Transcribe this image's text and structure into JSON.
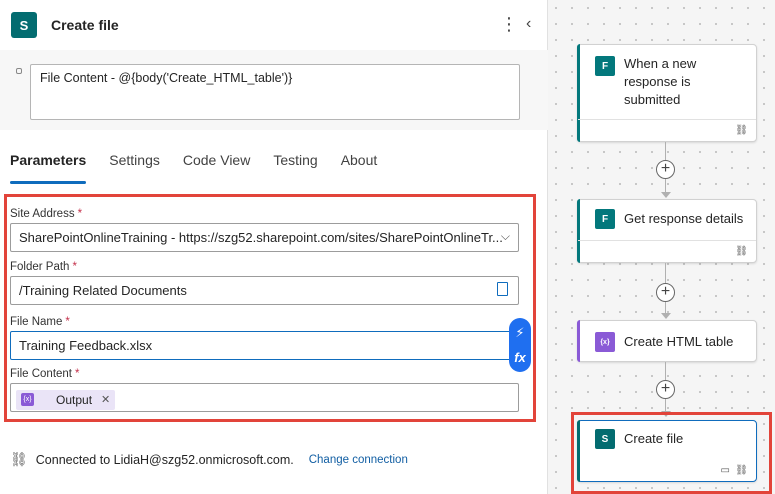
{
  "panel": {
    "title": "Create file",
    "logo_letter": "S",
    "description": "File Content - @{body('Create_HTML_table')}",
    "tabs": [
      {
        "label": "Parameters",
        "active": true
      },
      {
        "label": "Settings",
        "active": false
      },
      {
        "label": "Code View",
        "active": false
      },
      {
        "label": "Testing",
        "active": false
      },
      {
        "label": "About",
        "active": false
      }
    ],
    "fields": {
      "site_address": {
        "label": "Site Address",
        "required": "*",
        "value": "SharePointOnlineTraining - https://szg52.sharepoint.com/sites/SharePointOnlineTr..."
      },
      "folder_path": {
        "label": "Folder Path",
        "required": "*",
        "value": "/Training Related Documents"
      },
      "file_name": {
        "label": "File Name",
        "required": "*",
        "value": "Training Feedback.xlsx"
      },
      "file_content": {
        "label": "File Content",
        "required": "*",
        "token_label": "Output",
        "token_icon": "{x}"
      }
    },
    "dynamic_content_glyph": "⚡",
    "expression_glyph": "fx",
    "connection": {
      "text": "Connected to LidiaH@szg52.onmicrosoft.com.",
      "change_label": "Change connection"
    }
  },
  "flow": {
    "steps": [
      {
        "title": "When a new response is submitted",
        "icon": "forms-icon",
        "icon_color": "#03787c"
      },
      {
        "title": "Get response details",
        "icon": "forms-icon",
        "icon_color": "#03787c"
      },
      {
        "title": "Create HTML table",
        "icon": "data-operation-icon",
        "icon_color": "#8a5ad6"
      },
      {
        "title": "Create file",
        "icon": "sharepoint-icon",
        "icon_color": "#036c70"
      }
    ]
  },
  "colors": {
    "accent": "#0f6cbd",
    "highlight": "#e2443a",
    "sharepoint": "#036c70",
    "data_operation": "#8a5ad6"
  }
}
